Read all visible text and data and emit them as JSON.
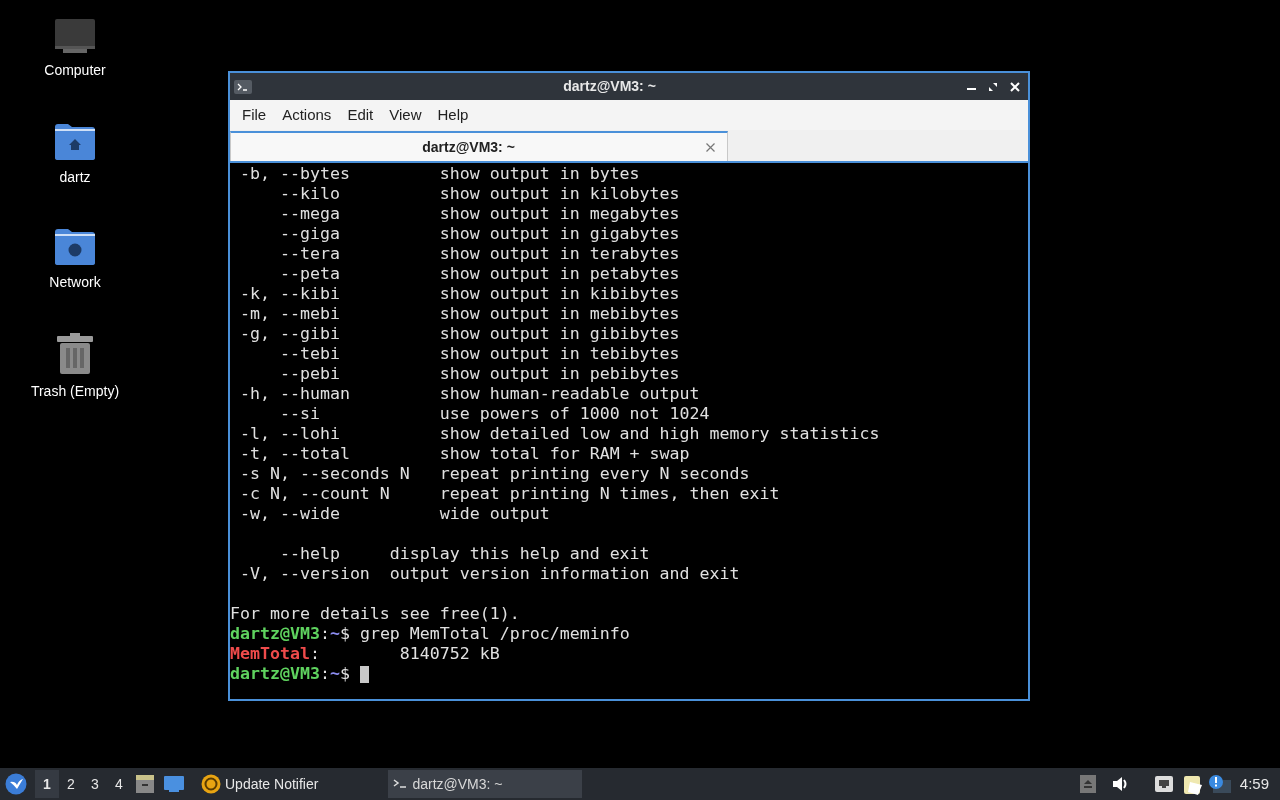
{
  "desktop_icons": [
    {
      "kind": "computer",
      "label": "Computer"
    },
    {
      "kind": "home",
      "label": "dartz"
    },
    {
      "kind": "network",
      "label": "Network"
    },
    {
      "kind": "trash",
      "label": "Trash (Empty)"
    }
  ],
  "window": {
    "title": "dartz@VM3: ~",
    "menu": [
      "File",
      "Actions",
      "Edit",
      "View",
      "Help"
    ],
    "tabs": [
      {
        "label": "dartz@VM3: ~",
        "selected": true
      }
    ],
    "terminal_lines": [
      {
        "kind": "output",
        "text": " -b, --bytes         show output in bytes"
      },
      {
        "kind": "output",
        "text": "     --kilo          show output in kilobytes"
      },
      {
        "kind": "output",
        "text": "     --mega          show output in megabytes"
      },
      {
        "kind": "output",
        "text": "     --giga          show output in gigabytes"
      },
      {
        "kind": "output",
        "text": "     --tera          show output in terabytes"
      },
      {
        "kind": "output",
        "text": "     --peta          show output in petabytes"
      },
      {
        "kind": "output",
        "text": " -k, --kibi          show output in kibibytes"
      },
      {
        "kind": "output",
        "text": " -m, --mebi          show output in mebibytes"
      },
      {
        "kind": "output",
        "text": " -g, --gibi          show output in gibibytes"
      },
      {
        "kind": "output",
        "text": "     --tebi          show output in tebibytes"
      },
      {
        "kind": "output",
        "text": "     --pebi          show output in pebibytes"
      },
      {
        "kind": "output",
        "text": " -h, --human         show human-readable output"
      },
      {
        "kind": "output",
        "text": "     --si            use powers of 1000 not 1024"
      },
      {
        "kind": "output",
        "text": " -l, --lohi          show detailed low and high memory statistics"
      },
      {
        "kind": "output",
        "text": " -t, --total         show total for RAM + swap"
      },
      {
        "kind": "output",
        "text": " -s N, --seconds N   repeat printing every N seconds"
      },
      {
        "kind": "output",
        "text": " -c N, --count N     repeat printing N times, then exit"
      },
      {
        "kind": "output",
        "text": " -w, --wide          wide output"
      },
      {
        "kind": "blank"
      },
      {
        "kind": "output",
        "text": "     --help     display this help and exit"
      },
      {
        "kind": "output",
        "text": " -V, --version  output version information and exit"
      },
      {
        "kind": "blank"
      },
      {
        "kind": "output",
        "text": "For more details see free(1)."
      },
      {
        "kind": "prompt",
        "user": "dartz@VM3",
        "sep": ":",
        "path": "~",
        "command": "$ grep MemTotal /proc/meminfo"
      },
      {
        "kind": "match",
        "key": "MemTotal",
        "rest": ":        8140752 kB"
      },
      {
        "kind": "prompt",
        "user": "dartz@VM3",
        "sep": ":",
        "path": "~",
        "command": "$ ",
        "cursor": true
      }
    ]
  },
  "taskbar": {
    "workspaces": [
      {
        "label": "1",
        "selected": true
      },
      {
        "label": "2",
        "selected": false
      },
      {
        "label": "3",
        "selected": false
      },
      {
        "label": "4",
        "selected": false
      }
    ],
    "tasks": [
      {
        "kind": "updater",
        "label": "Update Notifier",
        "selected": false
      },
      {
        "kind": "terminal",
        "label": "dartz@VM3: ~",
        "selected": true
      }
    ],
    "clock": "4:59"
  }
}
